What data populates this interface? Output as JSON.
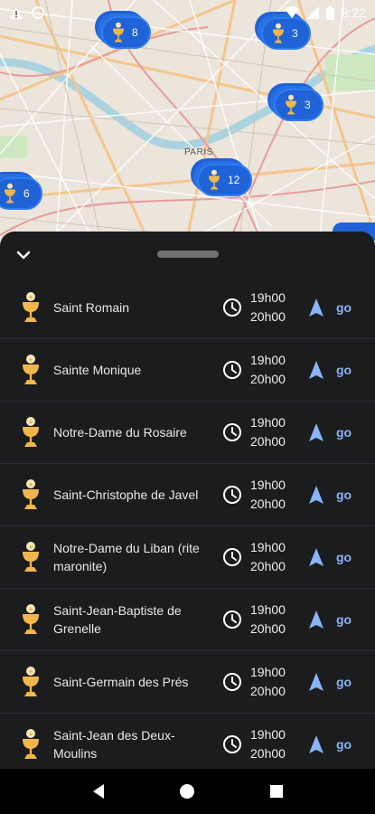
{
  "status_bar": {
    "time": "8:22",
    "icons": [
      "alert-icon",
      "circle-icon",
      "wifi-icon",
      "signal-icon",
      "battery-icon"
    ]
  },
  "map": {
    "labels": [
      "PARIS"
    ],
    "clusters": [
      {
        "count": "8"
      },
      {
        "count": "3"
      },
      {
        "count": "3"
      },
      {
        "count": "12"
      },
      {
        "count": "6"
      }
    ]
  },
  "sheet": {
    "collapse_icon": "chevron-down-icon",
    "rows": [
      {
        "name": "Saint Romain",
        "time1": "19h00",
        "time2": "20h00",
        "go": "go"
      },
      {
        "name": "Sainte Monique",
        "time1": "19h00",
        "time2": "20h00",
        "go": "go"
      },
      {
        "name": "Notre-Dame du Rosaire",
        "time1": "19h00",
        "time2": "20h00",
        "go": "go"
      },
      {
        "name": "Saint-Christophe de Javel",
        "time1": "19h00",
        "time2": "20h00",
        "go": "go"
      },
      {
        "name": "Notre-Dame du Liban (rite maronite)",
        "time1": "19h00",
        "time2": "20h00",
        "go": "go"
      },
      {
        "name": "Saint-Jean-Baptiste de Grenelle",
        "time1": "19h00",
        "time2": "20h00",
        "go": "go"
      },
      {
        "name": "Saint-Germain des Prés",
        "time1": "19h00",
        "time2": "20h00",
        "go": "go"
      },
      {
        "name": "Saint-Jean des Deux-Moulins",
        "time1": "19h00",
        "time2": "20h00",
        "go": "go"
      }
    ]
  },
  "colors": {
    "sheet_bg": "#1b1c1e",
    "cluster_blue": "#1f63d6",
    "link_blue": "#8ab4f8",
    "chalice_gold": "#f2b64a"
  }
}
